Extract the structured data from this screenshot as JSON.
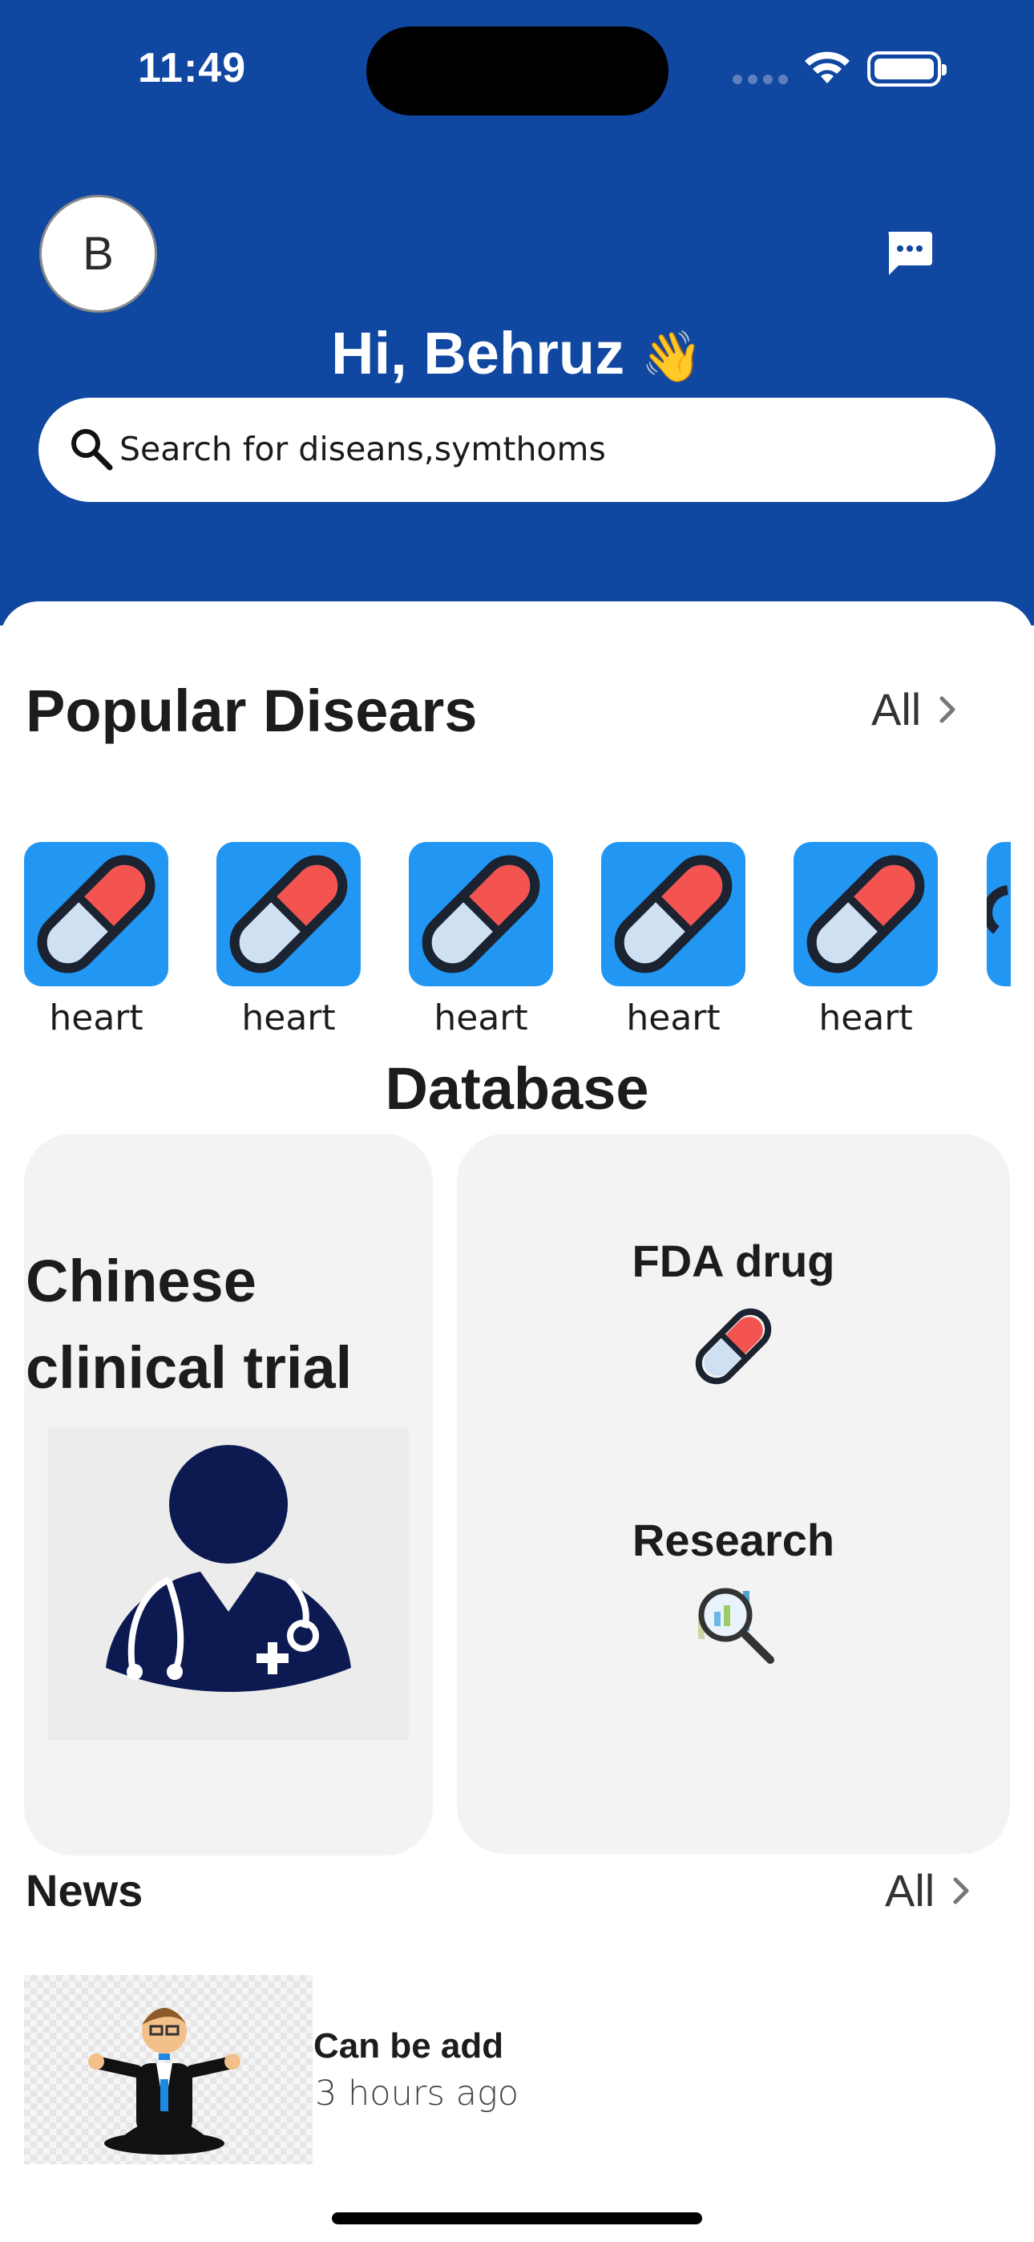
{
  "status_bar": {
    "time": "11:49"
  },
  "header": {
    "avatar_initial": "B",
    "greeting": "Hi, Behruz",
    "greeting_emoji": "👋",
    "background_color": "#0f47a1"
  },
  "search": {
    "placeholder": "Search for diseans,symthoms"
  },
  "popular": {
    "title": "Popular Disears",
    "all_label": "All",
    "items": [
      {
        "label": "heart",
        "icon": "pill-icon"
      },
      {
        "label": "heart",
        "icon": "pill-icon"
      },
      {
        "label": "heart",
        "icon": "pill-icon"
      },
      {
        "label": "heart",
        "icon": "pill-icon"
      },
      {
        "label": "heart",
        "icon": "pill-icon"
      }
    ],
    "icon_bg_color": "#2196f3"
  },
  "database": {
    "title": "Database",
    "left_card": {
      "title": "Chinese clinical trial",
      "icon": "doctor-icon"
    },
    "right_card": {
      "fda_label": "FDA drug",
      "fda_icon": "pill-icon",
      "research_label": "Research",
      "research_icon": "research-magnifier-icon"
    }
  },
  "news": {
    "title": "News",
    "all_label": "All",
    "items": [
      {
        "title": "Can be add",
        "time": "3 hours ago",
        "thumb": "cartoon-man-image"
      }
    ]
  }
}
